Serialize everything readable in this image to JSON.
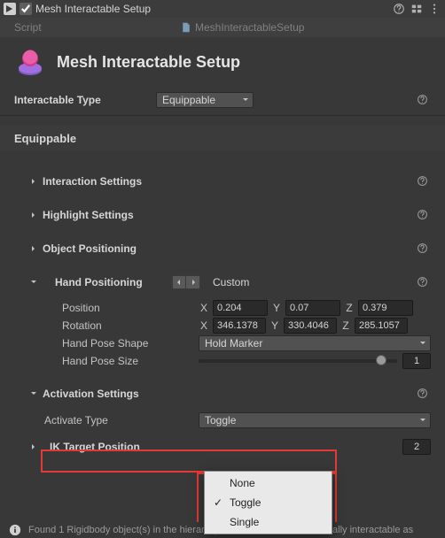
{
  "header": {
    "enabled": true,
    "title": "Mesh Interactable Setup"
  },
  "script": {
    "label": "Script",
    "value": "MeshInteractableSetup"
  },
  "component": {
    "title": "Mesh Interactable Setup"
  },
  "interactable_type": {
    "label": "Interactable Type",
    "value": "Equippable"
  },
  "equippable": {
    "title": "Equippable",
    "sections": {
      "interaction": "Interaction Settings",
      "highlight": "Highlight Settings",
      "object_pos": "Object Positioning",
      "hand_pos": {
        "label": "Hand Positioning",
        "value": "Custom",
        "position": {
          "label": "Position",
          "x": "0.204",
          "y": "0.07",
          "z": "0.379"
        },
        "rotation": {
          "label": "Rotation",
          "x": "346.1378",
          "y": "330.4046",
          "z": "285.1057"
        },
        "hand_pose_shape": {
          "label": "Hand Pose Shape",
          "value": "Hold Marker"
        },
        "hand_pose_size": {
          "label": "Hand Pose Size",
          "value": "1",
          "slider_pct": 92
        }
      },
      "activation": {
        "label": "Activation Settings",
        "activate_type": {
          "label": "Activate Type",
          "value": "Toggle"
        },
        "popup": {
          "options": [
            "None",
            "Toggle",
            "Single"
          ],
          "selected": "Toggle"
        }
      },
      "ik_target": {
        "label": "IK Target Position",
        "value": "2"
      }
    }
  },
  "axes": {
    "x": "X",
    "y": "Y",
    "z": "Z"
  },
  "bottom_message": "Found 1 Rigidbody object(s) in the hierarchy below that will be individually interactable as"
}
